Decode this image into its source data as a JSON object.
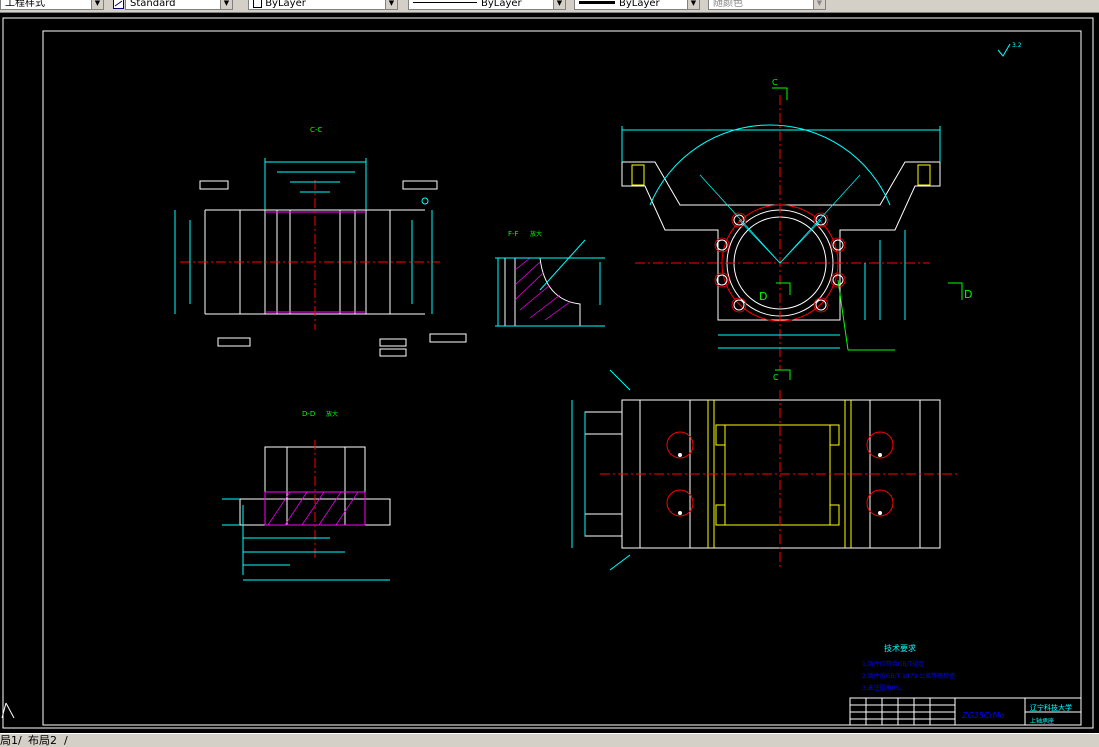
{
  "toolbar": {
    "text_style": "工程样式",
    "dim_style": "Standard",
    "layer_color": "ByLayer",
    "linetype": "ByLayer",
    "lineweight": "ByLayer",
    "plot_style": "随颜色"
  },
  "drawing": {
    "view_cc": "C-C",
    "view_ff": "F-F",
    "view_ff_note": "放大",
    "view_dd": "D-D",
    "view_dd_note": "放大",
    "section_c": "C",
    "section_d": "D",
    "roughness_label": "3.2",
    "tech_req_title": "技术要求",
    "tech_req_lines": [
      "1.铸件应符合GB/T规定",
      "2.铸件按GB/T 1873 公差等级检查",
      "3.未注圆角R5。"
    ],
    "material": "ZG35CrMo",
    "school": "辽宁科技大学",
    "part_name": "上轴承座"
  },
  "layout_tabs": [
    "局1",
    "布局2"
  ],
  "colors": {
    "outline": "#ffffff",
    "dimension": "#00ffff",
    "centerline": "#ff0000",
    "hidden": "#ffff00",
    "hatch": "#ff00ff",
    "text": "#00ff00"
  }
}
